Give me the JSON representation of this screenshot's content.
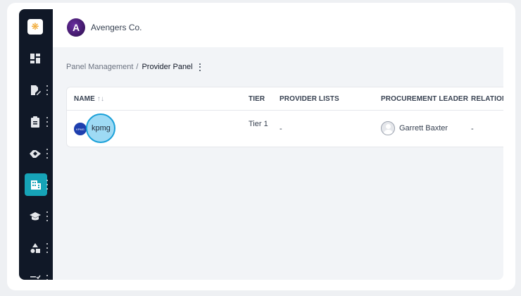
{
  "sidebar": {
    "logo_glyph": "❋",
    "items": [
      {
        "name": "dashboard",
        "icon": "dashboard-icon",
        "has_menu": false
      },
      {
        "name": "contracts",
        "icon": "document-edit-icon",
        "has_menu": true
      },
      {
        "name": "requests",
        "icon": "clipboard-icon",
        "has_menu": true
      },
      {
        "name": "partnerships",
        "icon": "handshake-icon",
        "has_menu": true
      },
      {
        "name": "providers",
        "icon": "building-icon",
        "has_menu": true,
        "active": true
      },
      {
        "name": "learning",
        "icon": "graduation-cap-icon",
        "has_menu": true
      },
      {
        "name": "categories",
        "icon": "shapes-icon",
        "has_menu": true
      },
      {
        "name": "tasks",
        "icon": "checklist-icon",
        "has_menu": true
      }
    ],
    "active_color": "#16a3b7"
  },
  "header": {
    "org_name": "Avengers Co.",
    "org_avatar_glyph": "A"
  },
  "breadcrumb": {
    "parent": "Panel Management",
    "separator": "/",
    "current": "Provider Panel"
  },
  "table": {
    "columns": {
      "name": "NAME",
      "name_sort": "↑↓",
      "tier": "TIER",
      "provider_lists": "PROVIDER LISTS",
      "procurement_leader": "PROCUREMENT LEADER",
      "relationship": "RELATION"
    },
    "rows": [
      {
        "logo_text": "KPMG",
        "name": "kpmg",
        "tier": "Tier 1",
        "provider_lists": "-",
        "procurement_leader": "Garrett Baxter",
        "relationship": "-"
      }
    ]
  }
}
